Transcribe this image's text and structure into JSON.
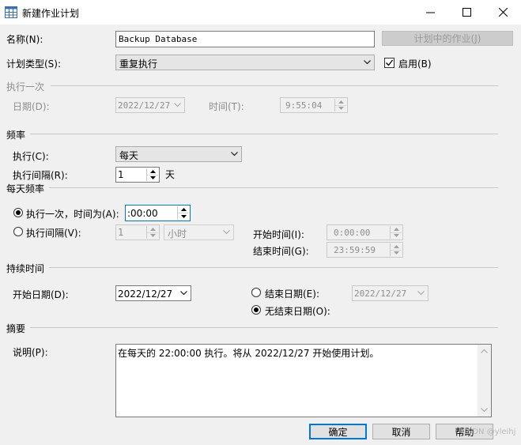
{
  "window": {
    "title": "新建作业计划"
  },
  "name": {
    "label": "名称(N):",
    "value": "Backup Database",
    "jobs_button": "计划中的作业(J)"
  },
  "schedule_type": {
    "label": "计划类型(S):",
    "value": "重复执行",
    "enabled_label": "启用(B)",
    "enabled": true
  },
  "once": {
    "section": "执行一次",
    "date_label": "日期(D):",
    "date_value": "2022/12/27",
    "time_label": "时间(T):",
    "time_value": "9:55:04"
  },
  "frequency": {
    "section": "频率",
    "occurs_label": "执行(C):",
    "occurs_value": "每天",
    "recurs_label": "执行间隔(R):",
    "recurs_value": "1",
    "recurs_unit": "天"
  },
  "daily": {
    "section": "每天频率",
    "once_label": "执行一次，时间为(A):",
    "once_value": ":00:00",
    "every_label": "执行间隔(V):",
    "every_value": "1",
    "every_unit": "小时",
    "start_label": "开始时间(I):",
    "start_value": "0:00:00",
    "end_label": "结束时间(G):",
    "end_value": "23:59:59"
  },
  "duration": {
    "section": "持续时间",
    "start_label": "开始日期(D):",
    "start_value": "2022/12/27",
    "end_label": "结束日期(E):",
    "end_value": "2022/12/27",
    "no_end_label": "无结束日期(O):"
  },
  "summary": {
    "section": "摘要",
    "desc_label": "说明(P):",
    "desc_value": "在每天的 22:00:00 执行。将从 2022/12/27 开始使用计划。"
  },
  "buttons": {
    "ok": "确定",
    "cancel": "取消",
    "help": "帮助"
  },
  "watermark": "CSDN @yleihj",
  "colors": {
    "accent": "#0078d7",
    "disabled_text": "#8d8d8d"
  }
}
